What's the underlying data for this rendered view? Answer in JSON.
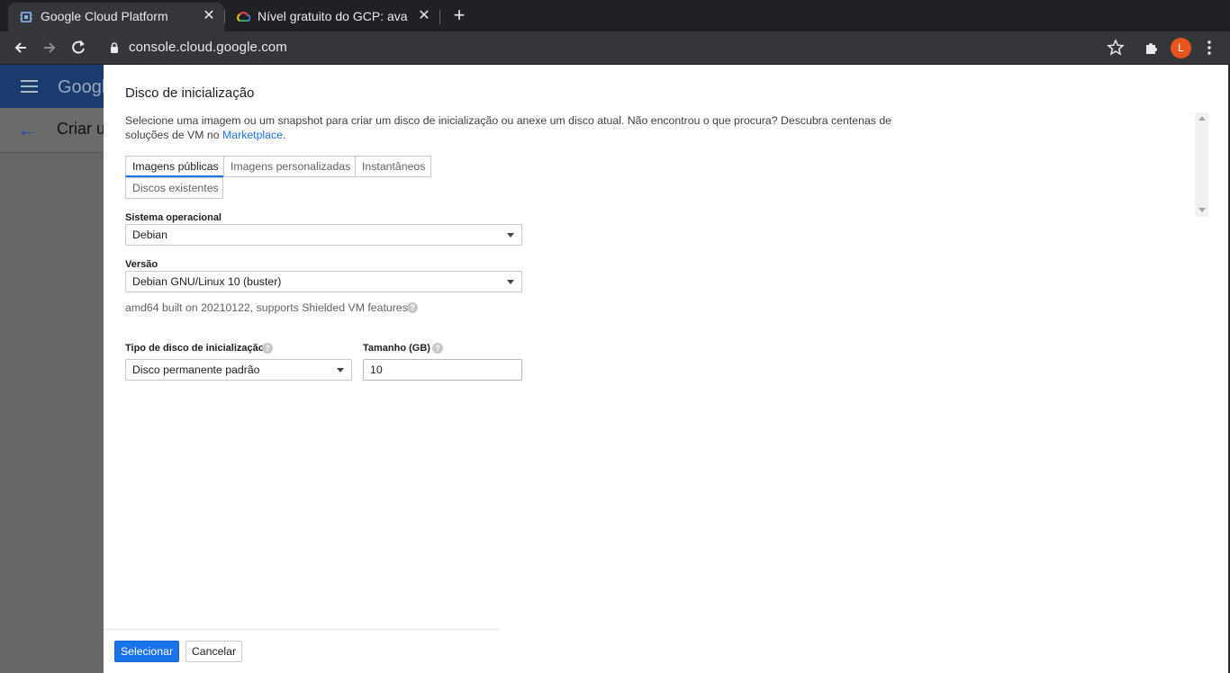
{
  "browser": {
    "tabs": [
      {
        "title": "Google Cloud Platform",
        "active": true,
        "favicon": "gcp-chip-icon"
      },
      {
        "title": "Nível gratuito do GCP: ava",
        "active": false,
        "favicon": "google-cloud-icon"
      }
    ],
    "url": "console.cloud.google.com",
    "avatar_letter": "L"
  },
  "background_page": {
    "logo_text": "Googl",
    "page_title": "Criar u"
  },
  "dialog": {
    "title": "Disco de inicialização",
    "description_part1": "Selecione uma imagem ou um snapshot para criar um disco de inicialização ou anexe um disco atual. Não encontrou o que procura? Descubra centenas de soluções de VM no ",
    "marketplace_link": "Marketplace",
    "description_end": ".",
    "tabs": [
      {
        "label": "Imagens públicas",
        "selected": true
      },
      {
        "label": "Imagens personalizadas",
        "selected": false
      },
      {
        "label": "Instantâneos",
        "selected": false
      },
      {
        "label": "Discos existentes",
        "selected": false
      }
    ],
    "os_label": "Sistema operacional",
    "os_value": "Debian",
    "version_label": "Versão",
    "version_value": "Debian GNU/Linux 10 (buster)",
    "version_note": "amd64 built on 20210122, supports Shielded VM features",
    "disk_type_label": "Tipo de disco de inicialização",
    "disk_type_value": "Disco permanente padrão",
    "size_label": "Tamanho (GB)",
    "size_value": "10",
    "select_button": "Selecionar",
    "cancel_button": "Cancelar",
    "colors": {
      "accent": "#1a73e8",
      "avatar": "#e8541e"
    }
  }
}
